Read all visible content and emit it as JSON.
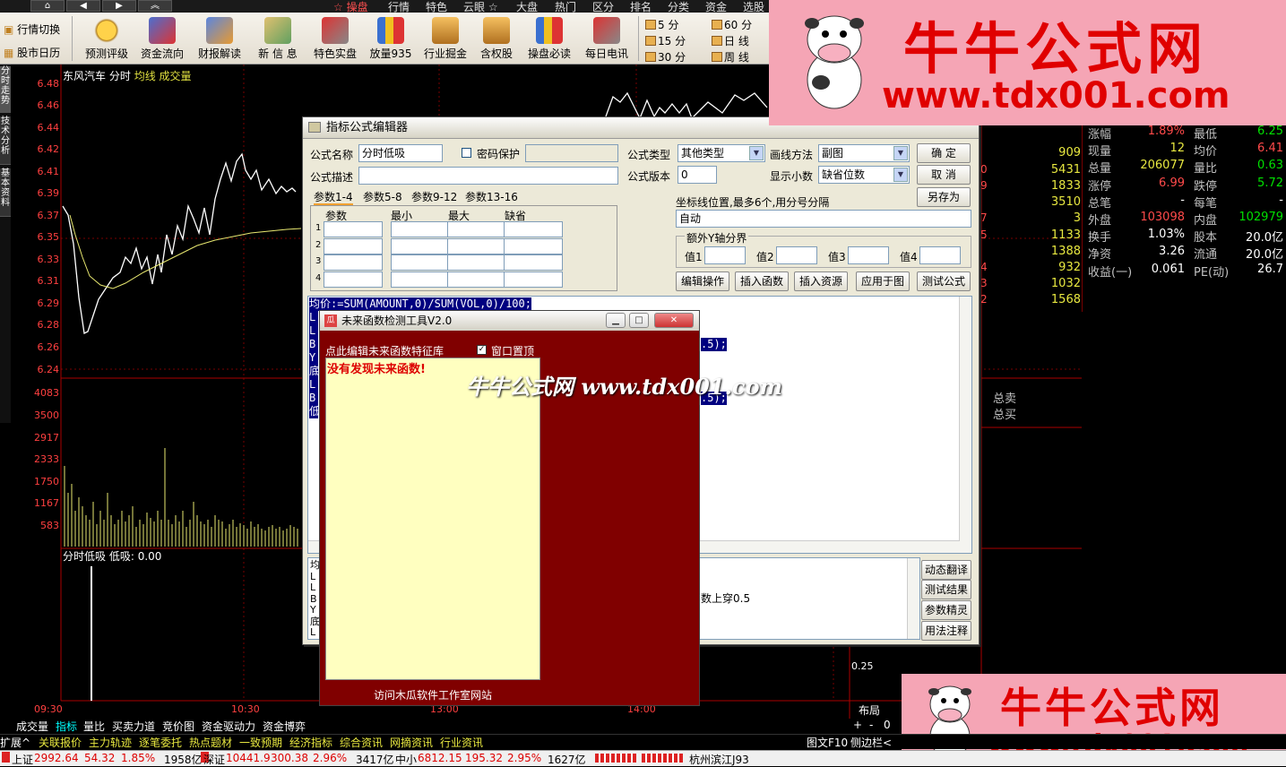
{
  "top_menu": {
    "items": [
      "☆ 操盘",
      "行情",
      "特色",
      "云眼 ☆",
      "大盘",
      "热门",
      "区分",
      "排名",
      "分类",
      "资金",
      "选股"
    ]
  },
  "toolbar": {
    "left_items": [
      "行情切换",
      "股市日历"
    ],
    "buttons": [
      "预测评级",
      "资金流向",
      "财报解读",
      "新 信 息",
      "特色实盘",
      "放量935",
      "行业掘金",
      "含权股",
      "操盘必读",
      "每日电讯"
    ],
    "periods_col1": [
      "5 分",
      "15 分",
      "30 分"
    ],
    "periods_col2": [
      "60 分",
      "日 线",
      "周 线"
    ]
  },
  "left_tabs": [
    "分时走势",
    "技术分析",
    "基本资料"
  ],
  "stock_header": {
    "name": "东风汽车",
    "mode": "分时",
    "line1": "均线",
    "line2": "成交量"
  },
  "price_axis": [
    "6.48",
    "6.46",
    "6.44",
    "6.42",
    "6.41",
    "6.39",
    "6.37",
    "6.35",
    "6.33",
    "6.31",
    "6.29",
    "6.28",
    "6.26",
    "6.24"
  ],
  "volume_axis": [
    "4083",
    "3500",
    "2917",
    "2333",
    "1750",
    "1167",
    "583"
  ],
  "indicator": {
    "label": "分时低吸",
    "value_label": "低吸: 0.00",
    "right_tick": "0.25"
  },
  "time_axis": [
    "09:30",
    "10:30",
    "13:00",
    "14:00"
  ],
  "right_panel": {
    "rows": [
      {
        "k": "涨幅",
        "v": "1.89%",
        "k2": "最低",
        "v2": "6.25"
      },
      {
        "k": "现量",
        "v": "12",
        "k2": "均价",
        "v2": "6.41"
      },
      {
        "k": "总量",
        "v": "206077",
        "k2": "量比",
        "v2": "0.63"
      },
      {
        "k": "涨停",
        "v": "6.99",
        "k2": "跌停",
        "v2": "5.72"
      },
      {
        "k": "总笔",
        "v": "-",
        "k2": "每笔",
        "v2": "-"
      },
      {
        "k": "外盘",
        "v": "103098",
        "k2": "内盘",
        "v2": "102979"
      },
      {
        "k": "换手",
        "v": "1.03%",
        "k2": "股本",
        "v2": "20.0亿"
      },
      {
        "k": "净资",
        "v": "3.26",
        "k2": "流通",
        "v2": "20.0亿"
      },
      {
        "k": "收益(一)",
        "v": "0.061",
        "k2": "PE(动)",
        "v2": "26.7"
      }
    ],
    "ladder": [
      "909",
      "5431",
      "1833",
      "3510",
      "3",
      "1133",
      "1388",
      "932",
      "1032",
      "1568"
    ],
    "ladder_prefix": [
      "0",
      "9",
      "7",
      "5",
      "4",
      "3",
      "2"
    ],
    "sell_total": "总卖",
    "buy_total": "总买"
  },
  "dialog": {
    "title": "指标公式编辑器",
    "name_label": "公式名称",
    "name_value": "分时低吸",
    "pwd_label": "密码保护",
    "desc_label": "公式描述",
    "type_label": "公式类型",
    "type_value": "其他类型",
    "draw_label": "画线方法",
    "draw_value": "副图",
    "version_label": "公式版本",
    "version_value": "0",
    "decimal_label": "显示小数",
    "decimal_value": "缺省位数",
    "ok": "确  定",
    "cancel": "取  消",
    "saveas": "另存为",
    "param_tabs": [
      "参数1-4",
      "参数5-8",
      "参数9-12",
      "参数13-16"
    ],
    "param_headers": [
      "参数",
      "最小",
      "最大",
      "缺省"
    ],
    "param_rows": [
      "1",
      "2",
      "3",
      "4"
    ],
    "coord_label": "坐标线位置,最多6个,用分号分隔",
    "coord_value": "自动",
    "yaxis_group": "额外Y轴分界",
    "yaxis_vals": [
      "值1",
      "值2",
      "值3",
      "值4"
    ],
    "actions": [
      "编辑操作",
      "插入函数",
      "插入资源",
      "应用于图",
      "测试公式"
    ],
    "code_first": "均价:=SUM(AMOUNT,0)/SUM(VOL,0)/100;",
    "code_tail1": ".5);",
    "code_tail2": ".5);",
    "code_letters": [
      "L",
      "L",
      "B",
      "Y",
      "底",
      "L",
      "B",
      "低"
    ],
    "lower_letters": [
      "均",
      "L",
      "L",
      "B",
      "Y",
      "底",
      "L"
    ],
    "lower_text": "数上穿0.5",
    "side_buttons": [
      "动态翻译",
      "测试结果",
      "参数精灵",
      "用法注释"
    ]
  },
  "popup": {
    "title": "未来函数检测工具V2.0",
    "edit_label": "点此编辑未来函数特征库",
    "top_label": "窗口置顶",
    "result": "没有发现未来函数!",
    "footer": "访问木瓜软件工作室网站"
  },
  "watermark": {
    "text1": "牛牛公式网",
    "url": "www.tdx001.com",
    "center": "牛牛公式网 www.tdx001.com"
  },
  "bottom_tabs": [
    "成交量",
    "指标",
    "量比",
    "买卖力道",
    "竞价图",
    "资金驱动力",
    "资金博弈"
  ],
  "bottom_right": {
    "layout": "布局",
    "plus": "+",
    "minus": "-",
    "zero": "0"
  },
  "bottom_row2": [
    "扩展^",
    "关联报价",
    "主力轨迹",
    "逐笔委托",
    "热点题材",
    "一致预期",
    "经济指标",
    "综合资讯",
    "网摘资讯",
    "行业资讯"
  ],
  "bottom_row2_right": [
    "图文F10",
    "侧边栏<"
  ],
  "status": {
    "sh_label": "上证",
    "sh_val": "2992.64",
    "sh_chg": "54.32",
    "sh_pct": "1.85%",
    "sh_amt": "1958亿",
    "sz_label": "深证",
    "sz_val": "10441.9",
    "sz_chg": "300.38",
    "sz_pct": "2.96%",
    "sz_amt": "3417亿",
    "zx_label": "中小",
    "zx_val": "6812.15",
    "zx_chg": "195.32",
    "zx_pct": "2.95%",
    "zx_amt": "1627亿",
    "location": "杭州滨江J93"
  }
}
